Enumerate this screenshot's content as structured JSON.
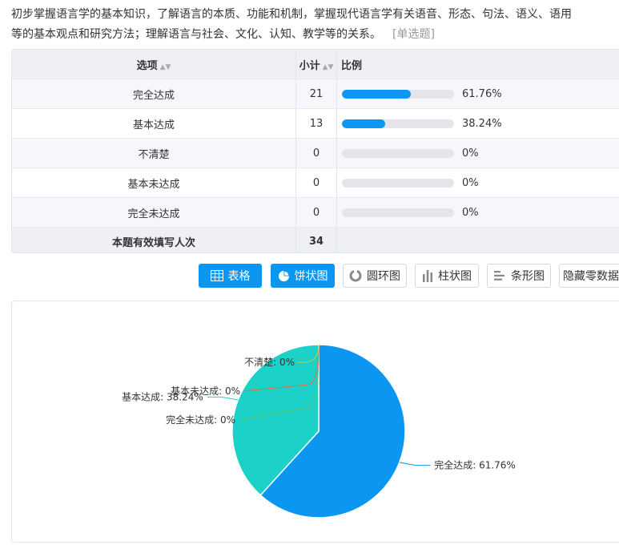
{
  "question": {
    "text": "初步掌握语言学的基本知识，了解语言的本质、功能和机制，掌握现代语言学有关语音、形态、句法、语义、语用等的基本观点和研究方法；理解语言与社会、文化、认知、教学等的关系。",
    "type_label": "[单选题]"
  },
  "table": {
    "headers": {
      "option": "选项",
      "count": "小计",
      "ratio": "比例"
    },
    "rows": [
      {
        "option": "完全达成",
        "count": "21",
        "ratio": "61.76%",
        "fraction": 0.6176
      },
      {
        "option": "基本达成",
        "count": "13",
        "ratio": "38.24%",
        "fraction": 0.3824
      },
      {
        "option": "不清楚",
        "count": "0",
        "ratio": "0%",
        "fraction": 0
      },
      {
        "option": "基本未达成",
        "count": "0",
        "ratio": "0%",
        "fraction": 0
      },
      {
        "option": "完全未达成",
        "count": "0",
        "ratio": "0%",
        "fraction": 0
      }
    ],
    "total": {
      "label": "本题有效填写人次",
      "count": "34"
    }
  },
  "toolbar": {
    "table": "表格",
    "pie": "饼状图",
    "donut": "圆环图",
    "column": "柱状图",
    "bar": "条形图",
    "hide_zero": "隐藏零数据"
  },
  "chart_data": {
    "type": "pie",
    "slices": [
      {
        "label": "完全达成",
        "value": 61.76,
        "color": "#0b96f2",
        "display": "完全达成: 61.76%"
      },
      {
        "label": "基本达成",
        "value": 38.24,
        "color": "#1cd1c7",
        "display": "基本达成: 38.24%"
      },
      {
        "label": "完全未达成",
        "value": 0,
        "color": "#5ec95a",
        "display": "完全未达成: 0%"
      },
      {
        "label": "基本未达成",
        "value": 0,
        "color": "#f06a3c",
        "display": "基本未达成: 0%"
      },
      {
        "label": "不清楚",
        "value": 0,
        "color": "#e7c61a",
        "display": "不清楚: 0%"
      }
    ]
  }
}
